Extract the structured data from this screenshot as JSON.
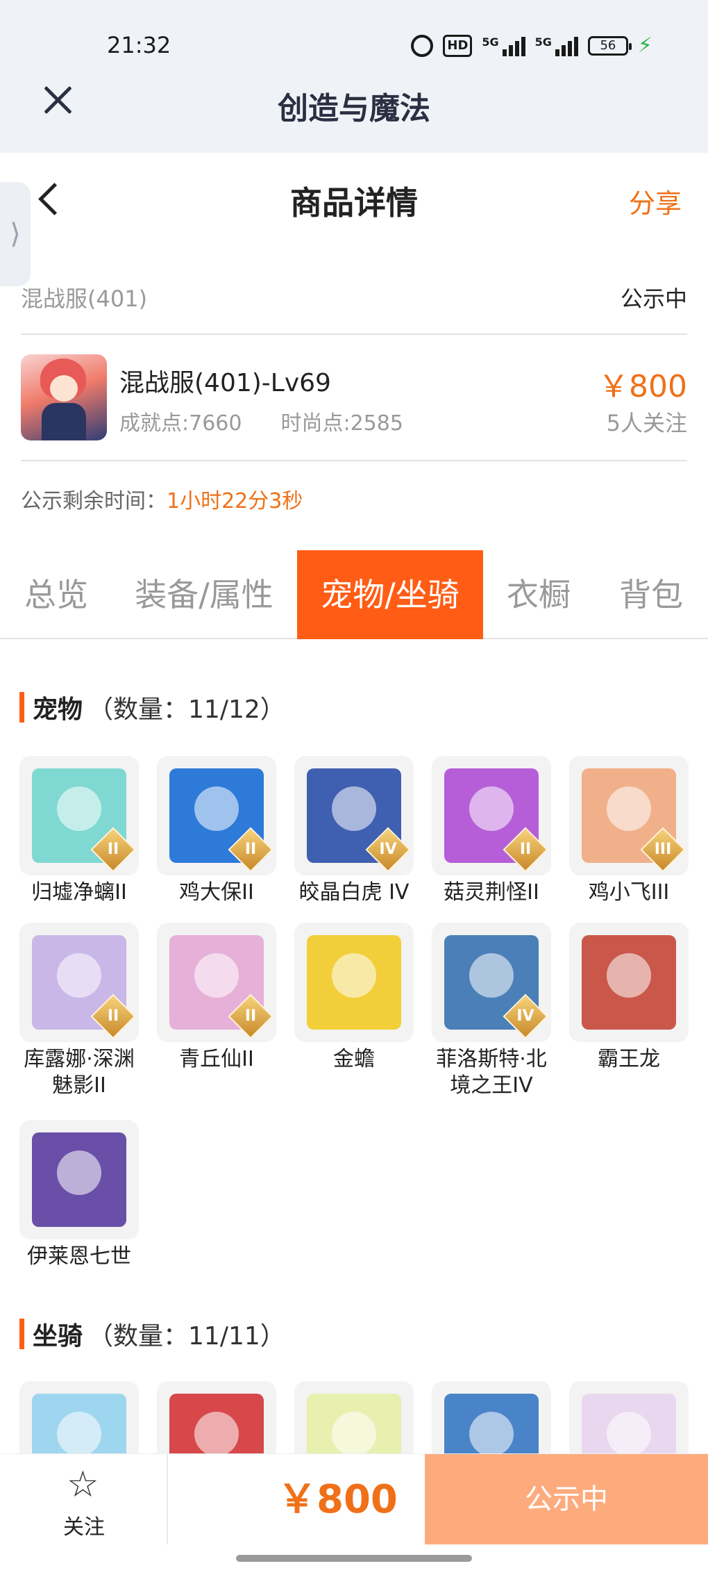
{
  "status_bar": {
    "time": "21:32",
    "hd_label": "HD",
    "sim1_label": "5G",
    "sim2_label": "5G",
    "battery": "56",
    "bolt": "⚡"
  },
  "app_bar": {
    "title": "创造与魔法",
    "close_icon": "close-icon"
  },
  "header": {
    "title": "商品详情",
    "share": "分享",
    "edge_glyph": "⟩"
  },
  "server": {
    "name": "混战服(401)",
    "status": "公示中"
  },
  "character": {
    "name": "混战服(401)-Lv69",
    "achievement": "成就点:7660",
    "fashion": "时尚点:2585",
    "price": "￥800",
    "followers": "5人关注"
  },
  "remaining": {
    "label": "公示剩余时间：",
    "value": "1小时22分3秒"
  },
  "tabs": [
    {
      "label": "总览"
    },
    {
      "label": "装备/属性"
    },
    {
      "label": "宠物/坐骑",
      "active": true
    },
    {
      "label": "衣橱"
    },
    {
      "label": "背包"
    }
  ],
  "pets": {
    "name": "宠物",
    "count": "（数量：11/12）",
    "items": [
      {
        "name": "归墟净螭II",
        "rank": "II",
        "color": "#7fd9d2"
      },
      {
        "name": "鸡大保II",
        "rank": "II",
        "color": "#2e7ad8"
      },
      {
        "name": "皎晶白虎 IV",
        "rank": "IV",
        "color": "#3f5fb0"
      },
      {
        "name": "菇灵荆怪II",
        "rank": "II",
        "color": "#b65ed8"
      },
      {
        "name": "鸡小飞III",
        "rank": "III",
        "color": "#f0b08a"
      },
      {
        "name": "库露娜·深渊魅影II",
        "rank": "II",
        "color": "#c9b7e8"
      },
      {
        "name": "青丘仙II",
        "rank": "II",
        "color": "#e6b0d8"
      },
      {
        "name": "金蟾",
        "rank": "",
        "color": "#f2cf3a"
      },
      {
        "name": "菲洛斯特·北境之王IV",
        "rank": "IV",
        "color": "#4a7fb8"
      },
      {
        "name": "霸王龙",
        "rank": "",
        "color": "#c9584a"
      },
      {
        "name": "伊莱恩七世",
        "rank": "",
        "color": "#6a4fa8"
      }
    ]
  },
  "mounts": {
    "name": "坐骑",
    "count": "（数量：11/11）",
    "items": [
      {
        "color": "#9fd6ef"
      },
      {
        "color": "#d7484a"
      },
      {
        "color": "#e8f0b0"
      },
      {
        "color": "#4a84c8"
      },
      {
        "color": "#e9d7ef"
      }
    ]
  },
  "bottom": {
    "follow_label": "关注",
    "star": "☆",
    "price": "￥800",
    "cta": "公示中"
  }
}
